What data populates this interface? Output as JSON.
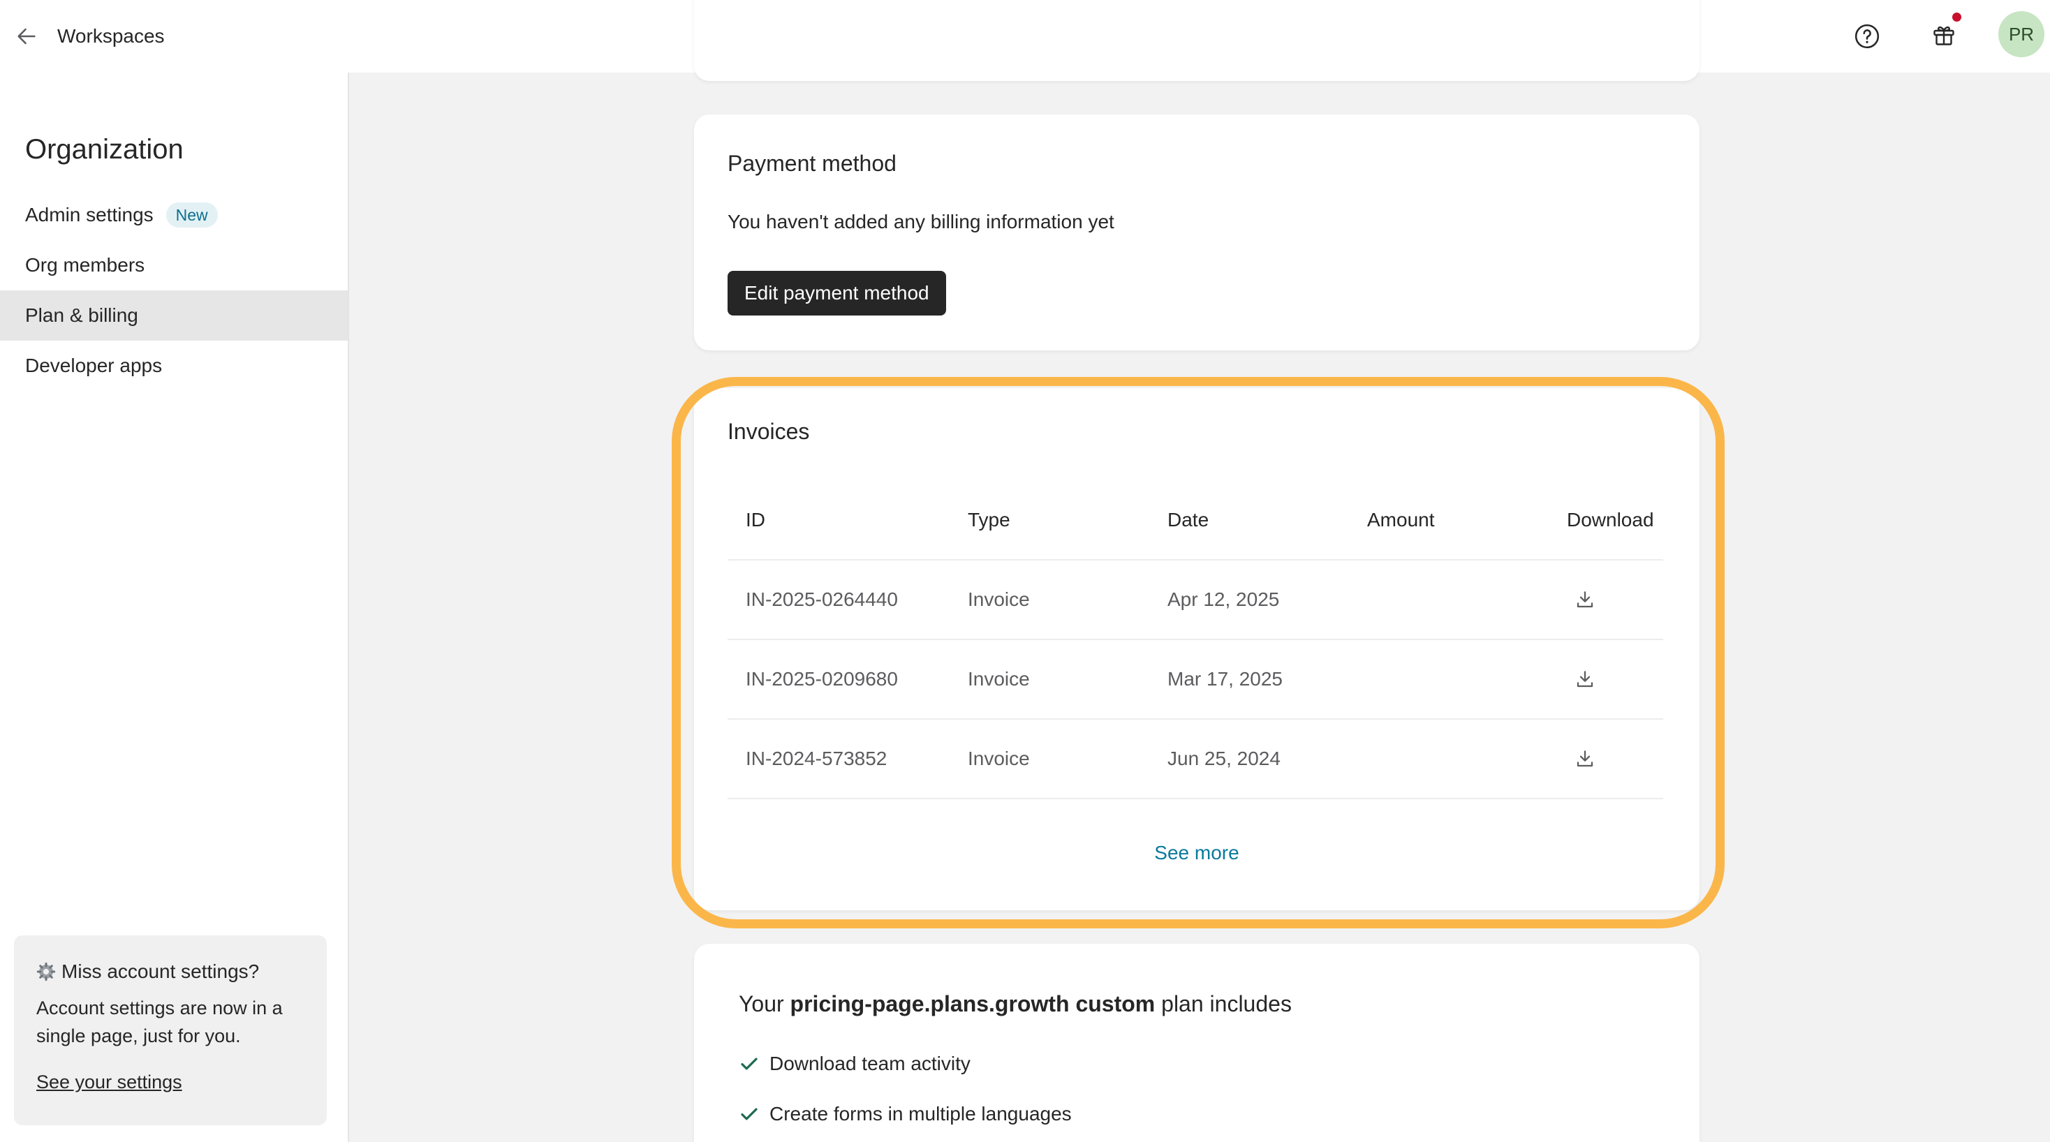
{
  "header": {
    "back_label": "Workspaces",
    "avatar_initials": "PR",
    "notification_color": "#c8102e"
  },
  "sidebar": {
    "title": "Organization",
    "items": [
      {
        "label": "Admin settings",
        "badge": "New"
      },
      {
        "label": "Org members"
      },
      {
        "label": "Plan & billing",
        "active": true
      },
      {
        "label": "Developer apps"
      }
    ],
    "notice": {
      "title": "Miss account settings?",
      "body": "Account settings are now in a single page, just for you.",
      "link": "See your settings"
    }
  },
  "payment": {
    "title": "Payment method",
    "text": "You haven't added any billing information yet",
    "button": "Edit payment method"
  },
  "invoices": {
    "title": "Invoices",
    "columns": [
      "ID",
      "Type",
      "Date",
      "Amount",
      "Download"
    ],
    "rows": [
      {
        "id": "IN-2025-0264440",
        "type": "Invoice",
        "date": "Apr 12, 2025",
        "amount": ""
      },
      {
        "id": "IN-2025-0209680",
        "type": "Invoice",
        "date": "Mar 17, 2025",
        "amount": ""
      },
      {
        "id": "IN-2024-573852",
        "type": "Invoice",
        "date": "Jun 25, 2024",
        "amount": ""
      }
    ],
    "see_more": "See more",
    "highlight_color": "#fbb64a"
  },
  "plan": {
    "prefix": "Your",
    "plan_name": "pricing-page.plans.growth custom",
    "suffix": "plan includes",
    "features": [
      "Download team activity",
      "Create forms in multiple languages"
    ]
  }
}
